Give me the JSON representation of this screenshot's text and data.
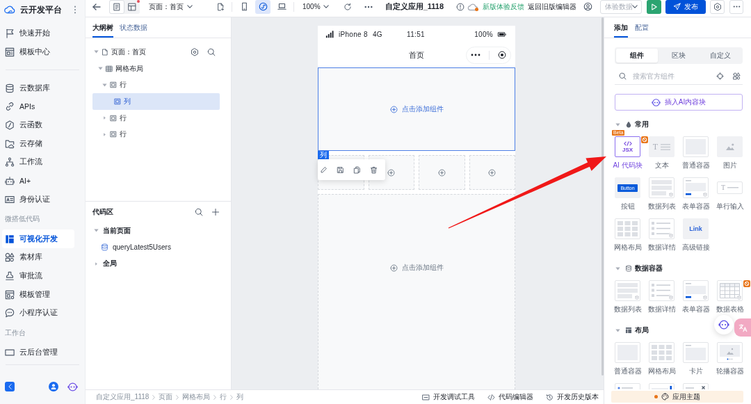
{
  "sidebar": {
    "logo": "云开发平台",
    "groups": [
      {
        "items": [
          {
            "label": "快速开始",
            "selected": false
          },
          {
            "label": "模板中心",
            "selected": false
          }
        ]
      },
      {
        "items": [
          {
            "label": "云数据库",
            "selected": false
          },
          {
            "label": "APIs",
            "selected": false
          },
          {
            "label": "云函数",
            "selected": false
          },
          {
            "label": "云存储",
            "selected": false
          },
          {
            "label": "工作流",
            "selected": false
          },
          {
            "label": "AI+",
            "selected": false
          },
          {
            "label": "身份认证",
            "selected": false
          }
        ]
      },
      {
        "title": "微搭低代码",
        "items": [
          {
            "label": "可视化开发",
            "selected": true
          },
          {
            "label": "素材库",
            "selected": false
          },
          {
            "label": "审批流",
            "selected": false
          },
          {
            "label": "模板管理",
            "selected": false
          },
          {
            "label": "小程序认证",
            "selected": false
          }
        ]
      },
      {
        "title": "工作台",
        "items": [
          {
            "label": "云后台管理",
            "selected": false
          }
        ]
      }
    ]
  },
  "toolbar": {
    "view_modes": [
      {
        "selected": true,
        "dot": false
      },
      {
        "selected": false,
        "dot": true
      }
    ],
    "page_selector": "页面：首页",
    "device_modes": [
      {
        "selected": false
      },
      {
        "selected": true
      },
      {
        "selected": false
      }
    ],
    "zoom": "100%",
    "app_title": "自定义应用_1118",
    "cloud_alert": true,
    "feedback_link": "新版体验反馈",
    "legacy_link": "返回旧版编辑器",
    "data_select": {
      "placeholder": "体验数据"
    },
    "publish": "发布"
  },
  "outline": {
    "tabs": [
      {
        "label": "大纲树",
        "selected": true
      },
      {
        "label": "状态数据",
        "selected": false
      }
    ],
    "tree": [
      {
        "kind": "page",
        "label": "页面：首页",
        "expanded": true,
        "selected": false,
        "children": [
          {
            "kind": "grid",
            "label": "网格布局",
            "expanded": true,
            "selected": false,
            "children": [
              {
                "kind": "box",
                "label": "行",
                "expanded": true,
                "selected": false,
                "children": [
                  {
                    "kind": "box",
                    "label": "列",
                    "selected": true
                  }
                ]
              },
              {
                "kind": "box",
                "label": "行",
                "expanded": false,
                "selected": false
              },
              {
                "kind": "box",
                "label": "行",
                "expanded": false,
                "selected": false
              }
            ]
          }
        ]
      }
    ]
  },
  "code": {
    "title": "代码区",
    "groups": [
      {
        "label": "当前页面",
        "expanded": true,
        "items": [
          "queryLatest5Users"
        ]
      },
      {
        "label": "全局",
        "expanded": false
      }
    ]
  },
  "phone": {
    "device": "iPhone 8",
    "network": "4G",
    "time": "11:51",
    "battery": "100%",
    "title": "首页",
    "blocks": [
      {
        "kind": "drop",
        "prompt": "点击添加组件",
        "selected": true,
        "tag": "列"
      },
      {
        "kind": "cells"
      },
      {
        "kind": "drop",
        "prompt": "点击添加组件",
        "selected": false
      }
    ]
  },
  "panel": {
    "tabs": [
      {
        "label": "添加",
        "selected": true
      },
      {
        "label": "配置",
        "selected": false
      }
    ],
    "segments": [
      {
        "label": "组件",
        "selected": true
      },
      {
        "label": "区块",
        "selected": false
      },
      {
        "label": "自定义",
        "selected": false
      }
    ],
    "search": {
      "placeholder": "搜索官方组件"
    },
    "ai_button": "插入AI内容块",
    "sections": [
      {
        "title": "常用",
        "expanded": true,
        "items": [
          {
            "kind": "jsx",
            "label": "AI 代码块",
            "tile_text": "JSX",
            "tag": "Beta"
          },
          {
            "kind": "text",
            "label": "文本",
            "tile_text": "T"
          },
          {
            "kind": "container",
            "label": "普通容器"
          },
          {
            "kind": "image",
            "label": "图片"
          },
          {
            "kind": "button",
            "label": "按钮",
            "tile_text": "Button"
          },
          {
            "kind": "list",
            "label": "数据列表"
          },
          {
            "kind": "form",
            "label": "表单容器"
          },
          {
            "kind": "input",
            "label": "单行输入",
            "tile_text": "T"
          },
          {
            "kind": "grid",
            "label": "网格布局"
          },
          {
            "kind": "detail",
            "label": "数据详情"
          },
          {
            "kind": "link",
            "label": "高级链接",
            "tile_text": "Link"
          }
        ]
      },
      {
        "title": "数据容器",
        "expanded": true,
        "items": [
          {
            "kind": "list",
            "label": "数据列表"
          },
          {
            "kind": "detail",
            "label": "数据详情"
          },
          {
            "kind": "form",
            "label": "表单容器"
          },
          {
            "kind": "table",
            "label": "数据表格"
          }
        ]
      },
      {
        "title": "布局",
        "expanded": true,
        "items": [
          {
            "kind": "container",
            "label": "普通容器"
          },
          {
            "kind": "grid",
            "label": "网格布局"
          },
          {
            "kind": "card",
            "label": "卡片"
          },
          {
            "kind": "carousel",
            "label": "轮播容器"
          },
          {
            "kind": "nav"
          },
          {
            "kind": "scroll"
          },
          {
            "kind": "popup"
          }
        ]
      }
    ],
    "theme": {
      "label": "应用主题",
      "dot": true
    }
  },
  "bottom_bar": {
    "breadcrumb": [
      "自定义应用_1118",
      "页面",
      "网格布局",
      "行",
      "列"
    ],
    "tools": [
      "开发调试工具",
      "代码编辑器",
      "开发历史版本"
    ]
  },
  "annotations": [
    {
      "kind": "arrow"
    }
  ]
}
